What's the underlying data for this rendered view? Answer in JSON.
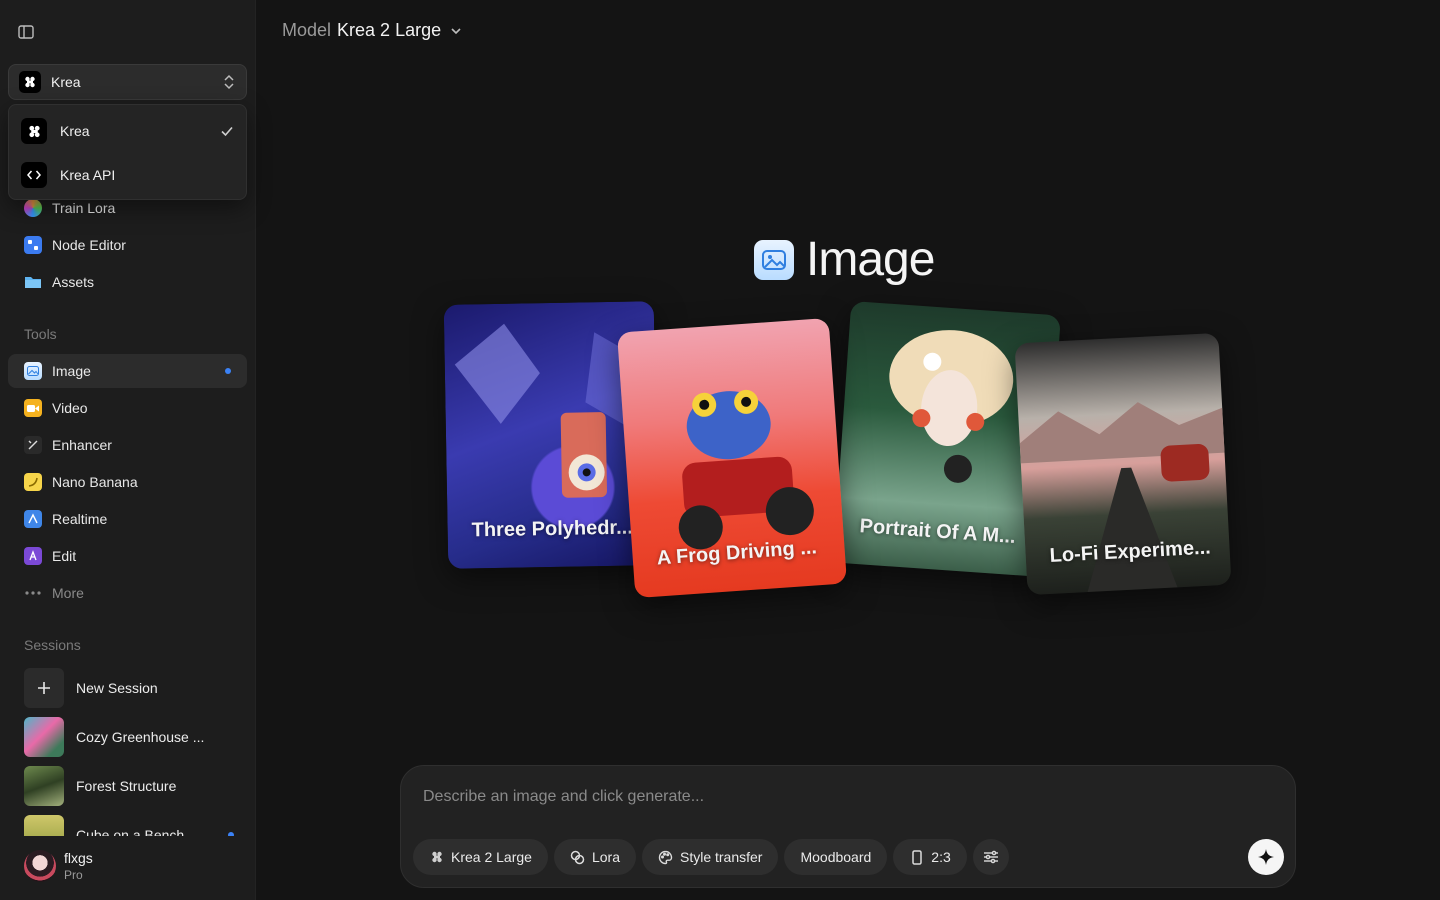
{
  "sidebar": {
    "workspace": {
      "selected": "Krea"
    },
    "workspace_menu": [
      {
        "label": "Krea",
        "icon": "krea-logo-icon",
        "checked": true
      },
      {
        "label": "Krea API",
        "icon": "code-icon",
        "checked": false
      }
    ],
    "nav": [
      {
        "label": "Train Lora",
        "icon": "lora-icon"
      },
      {
        "label": "Node Editor",
        "icon": "node-icon"
      },
      {
        "label": "Assets",
        "icon": "folder-icon"
      }
    ],
    "tools_label": "Tools",
    "tools": [
      {
        "label": "Image",
        "icon": "image-icon",
        "active": true
      },
      {
        "label": "Video",
        "icon": "video-icon"
      },
      {
        "label": "Enhancer",
        "icon": "enhancer-icon"
      },
      {
        "label": "Nano Banana",
        "icon": "banana-icon"
      },
      {
        "label": "Realtime",
        "icon": "realtime-icon"
      },
      {
        "label": "Edit",
        "icon": "edit-icon"
      },
      {
        "label": "More",
        "icon": "ellipsis-icon"
      }
    ],
    "sessions_label": "Sessions",
    "sessions": [
      {
        "label": "New Session"
      },
      {
        "label": "Cozy Greenhouse ..."
      },
      {
        "label": "Forest Structure"
      },
      {
        "label": "Cube on a Bench"
      }
    ],
    "user": {
      "name": "flxgs",
      "plan": "Pro"
    }
  },
  "header": {
    "model_key": "Model",
    "model_value": "Krea 2 Large"
  },
  "hero": {
    "title": "Image"
  },
  "cards": [
    {
      "caption": "Three Polyhedr..."
    },
    {
      "caption": "A Frog Driving ..."
    },
    {
      "caption": "Portrait Of A M..."
    },
    {
      "caption": "Lo-Fi Experime..."
    }
  ],
  "prompt": {
    "placeholder": "Describe an image and click generate...",
    "chips": {
      "model": "Krea 2 Large",
      "lora": "Lora",
      "style": "Style transfer",
      "moodboard": "Moodboard",
      "ratio": "2:3"
    }
  },
  "colors": {
    "accent": "#3b82f6",
    "background": "#141414",
    "sidebar": "#1d1d1d"
  }
}
